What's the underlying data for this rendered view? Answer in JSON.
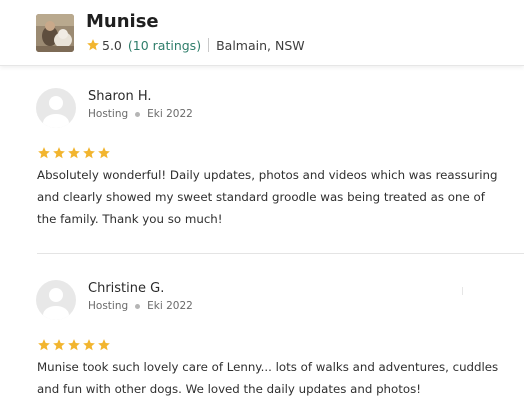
{
  "sitter": {
    "name": "Munise",
    "rating": "5.0",
    "ratings_count": "(10 ratings)",
    "location": "Balmain, NSW"
  },
  "reviews": [
    {
      "name": "Sharon H.",
      "service": "Hosting",
      "date": "Eki 2022",
      "stars": 5,
      "text": "Absolutely wonderful! Daily updates, photos and videos which was reassuring and clearly showed my sweet standard groodle was being treated as one of the family. Thank you so much!"
    },
    {
      "name": "Christine G.",
      "service": "Hosting",
      "date": "Eki 2022",
      "stars": 5,
      "text": "Munise took such lovely care of Lenny... lots of walks and adventures, cuddles and fun with other dogs. We loved the daily updates and photos!"
    }
  ],
  "colors": {
    "star": "#f2b52f",
    "link": "#2e7d6a",
    "avatar_bg": "#e8e8e8"
  }
}
